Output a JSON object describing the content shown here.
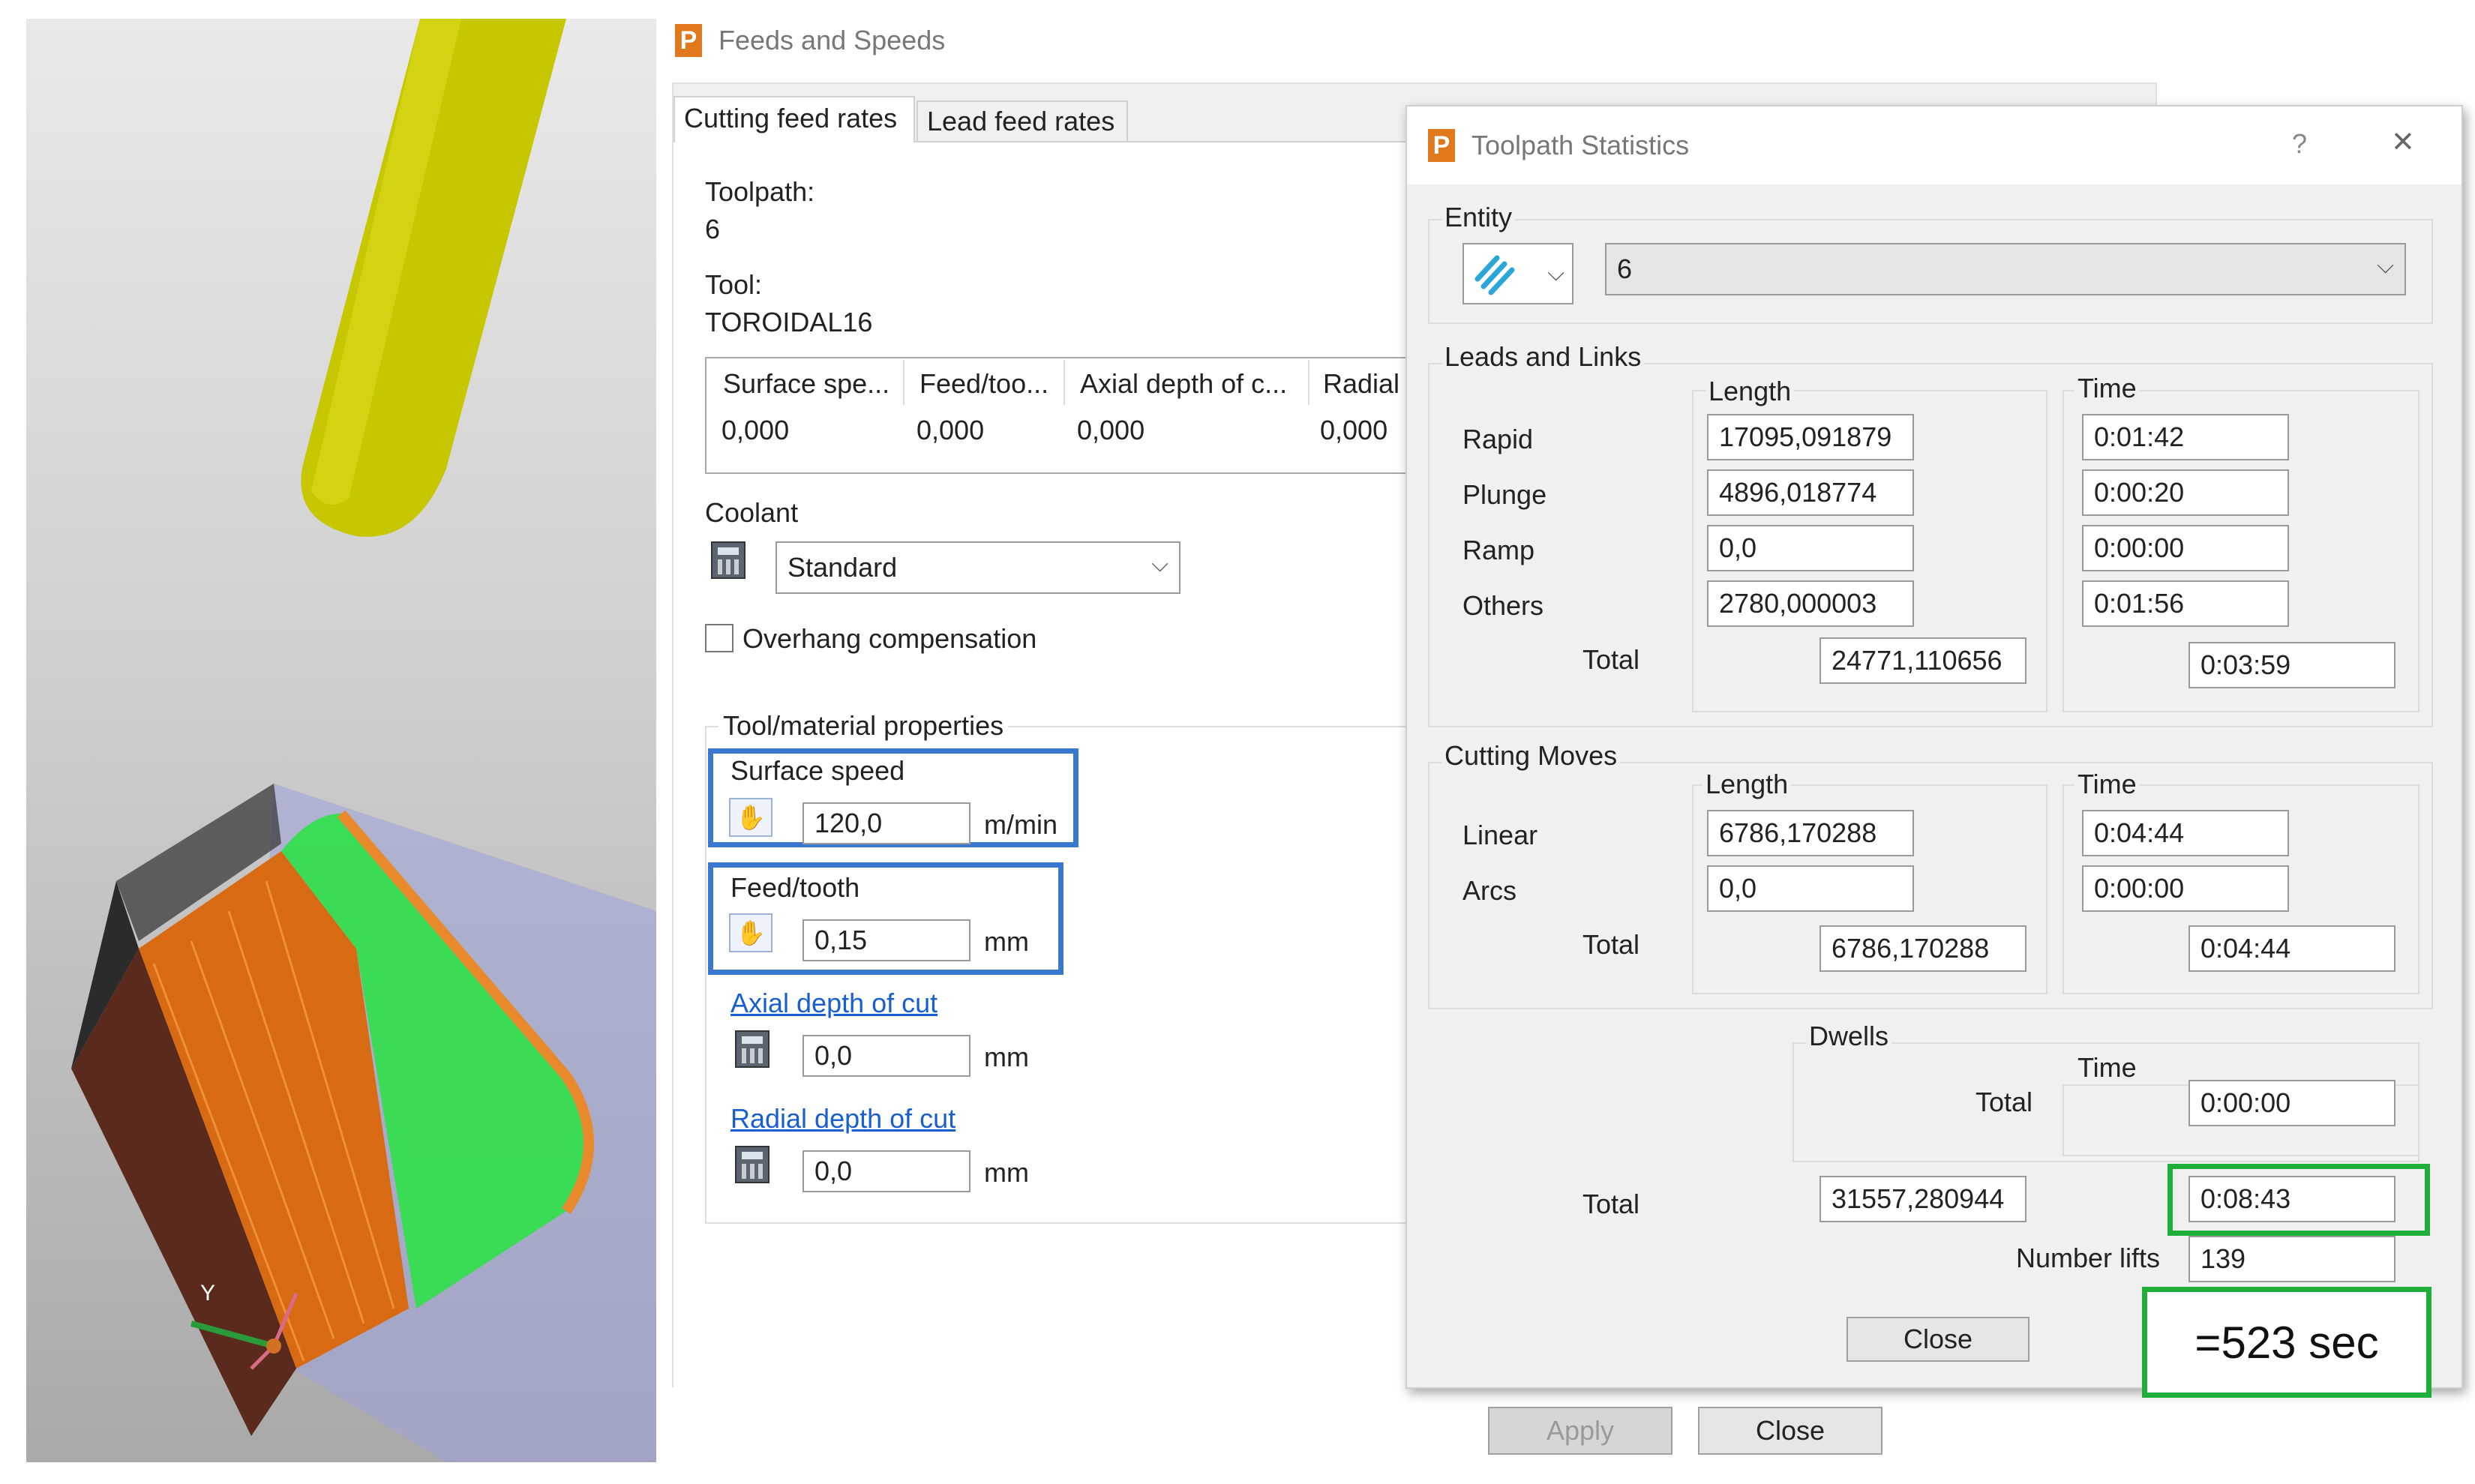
{
  "feeds_dialog": {
    "title": "Feeds and Speeds",
    "tabs": [
      "Cutting feed rates",
      "Lead feed rates"
    ],
    "toolpath_label": "Toolpath:",
    "toolpath_value": "6",
    "tool_label": "Tool:",
    "tool_value": "TOROIDAL16",
    "table": {
      "headers": [
        "Surface spe...",
        "Feed/too...",
        "Axial depth of c...",
        "Radial"
      ],
      "row": [
        "0,000",
        "0,000",
        "0,000",
        "0,000"
      ]
    },
    "coolant_label": "Coolant",
    "coolant_value": "Standard",
    "overhang_label": "Overhang compensation",
    "properties_label": "Tool/material properties",
    "surface_speed_label": "Surface speed",
    "surface_speed_value": "120,0",
    "surface_speed_unit": "m/min",
    "feed_tooth_label": "Feed/tooth",
    "feed_tooth_value": "0,15",
    "feed_tooth_unit": "mm",
    "axial_label": "Axial depth of cut",
    "axial_value": "0,0",
    "axial_unit": "mm",
    "radial_label": "Radial depth of cut",
    "radial_value": "0,0",
    "radial_unit": "mm",
    "apply_label": "Apply",
    "close_label": "Close"
  },
  "stats_dialog": {
    "title": "Toolpath Statistics",
    "help": "?",
    "close_x": "✕",
    "entity_label": "Entity",
    "entity_value": "6",
    "leads_links_label": "Leads and Links",
    "length_label": "Length",
    "time_label": "Time",
    "rows": [
      {
        "label": "Rapid",
        "length": "17095,091879",
        "time": "0:01:42"
      },
      {
        "label": "Plunge",
        "length": "4896,018774",
        "time": "0:00:20"
      },
      {
        "label": "Ramp",
        "length": "0,0",
        "time": "0:00:00"
      },
      {
        "label": "Others",
        "length": "2780,000003",
        "time": "0:01:56"
      }
    ],
    "total_label": "Total",
    "leads_total_length": "24771,110656",
    "leads_total_time": "0:03:59",
    "cutting_moves_label": "Cutting Moves",
    "cut_rows": [
      {
        "label": "Linear",
        "length": "6786,170288",
        "time": "0:04:44"
      },
      {
        "label": "Arcs",
        "length": "0,0",
        "time": "0:00:00"
      }
    ],
    "cut_total_length": "6786,170288",
    "cut_total_time": "0:04:44",
    "dwells_label": "Dwells",
    "dwells_total_time": "0:00:00",
    "grand_total_length": "31557,280944",
    "grand_total_time": "0:08:43",
    "lifts_label": "Number lifts",
    "lifts_value": "139",
    "close_label": "Close"
  },
  "annotation": "=523 sec",
  "viewport": {
    "axis_y_label": "Y"
  },
  "colors": {
    "highlight_blue": "#3a78d0",
    "highlight_green": "#1fae3a",
    "tool_yellow": "#c8c800",
    "toolpath_green": "#2ee04a",
    "toolpath_orange": "#e07a1c"
  }
}
